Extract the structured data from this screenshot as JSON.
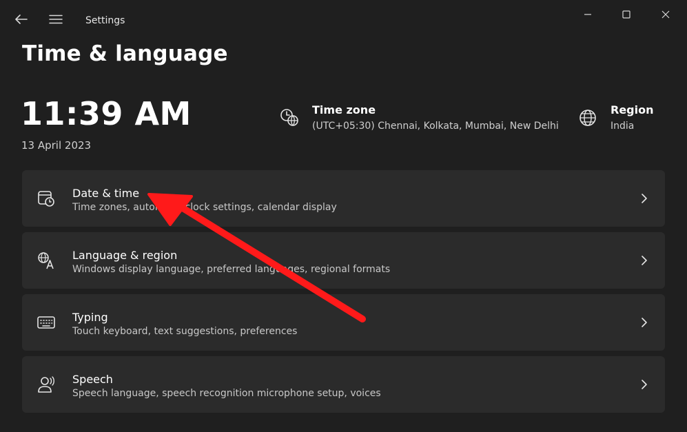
{
  "app": {
    "title": "Settings"
  },
  "page": {
    "title": "Time & language"
  },
  "summary": {
    "time": "11:39 AM",
    "date": "13 April 2023",
    "timezone": {
      "label": "Time zone",
      "value": "(UTC+05:30) Chennai, Kolkata, Mumbai, New Delhi"
    },
    "region": {
      "label": "Region",
      "value": "India"
    }
  },
  "cards": [
    {
      "title": "Date & time",
      "subtitle": "Time zones, automatic clock settings, calendar display",
      "icon": "calendar-clock-icon"
    },
    {
      "title": "Language & region",
      "subtitle": "Windows display language, preferred languages, regional formats",
      "icon": "language-icon"
    },
    {
      "title": "Typing",
      "subtitle": "Touch keyboard, text suggestions, preferences",
      "icon": "keyboard-icon"
    },
    {
      "title": "Speech",
      "subtitle": "Speech language, speech recognition microphone setup, voices",
      "icon": "speech-icon"
    }
  ],
  "colors": {
    "background": "#1f1f1f",
    "card": "#2b2b2b",
    "annotation_arrow": "#ff1a1a"
  }
}
